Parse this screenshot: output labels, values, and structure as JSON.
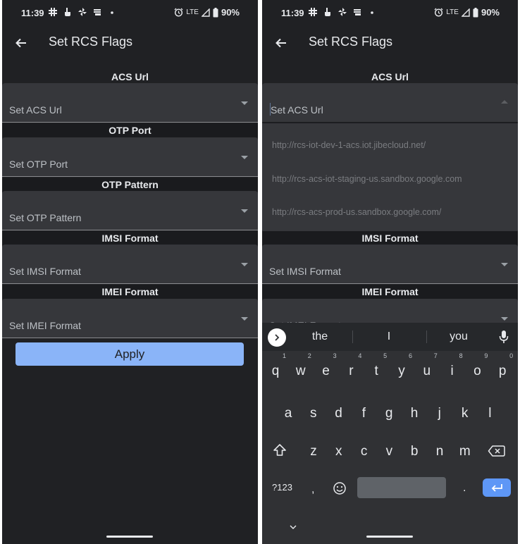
{
  "status_bar": {
    "time": "11:39",
    "left_icons": [
      "slack-icon",
      "hand-touch-icon",
      "pinwheel-icon",
      "notification-card-icon",
      "dot-icon"
    ],
    "right_icons": [
      "alarm-icon",
      "lte-label",
      "signal-icon",
      "battery-icon"
    ],
    "network": "LTE",
    "battery": "90%"
  },
  "app_bar": {
    "title": "Set RCS Flags",
    "back_icon": "arrow-back-icon"
  },
  "left_screen": {
    "sections": [
      {
        "header": "ACS Url",
        "value": "Set ACS Url"
      },
      {
        "header": "OTP Port",
        "value": "Set OTP Port"
      },
      {
        "header": "OTP Pattern",
        "value": "Set OTP Pattern"
      },
      {
        "header": "IMSI Format",
        "value": "Set IMSI Format"
      },
      {
        "header": "IMEI Format",
        "value": "Set IMEI Format"
      }
    ],
    "apply_label": "Apply"
  },
  "right_screen": {
    "sections": [
      {
        "header": "ACS Url",
        "value": "Set ACS Url"
      },
      {
        "header": "IMSI Format",
        "value": "Set IMSI Format"
      },
      {
        "header": "IMEI Format",
        "value": "Set IMEI Format"
      }
    ],
    "dropdown_options": [
      "http://rcs-iot-dev-1-acs.iot.jibecloud.net/",
      "http://rcs-acs-iot-staging-us.sandbox.google.com",
      "http://rcs-acs-prod-us.sandbox.google.com/"
    ]
  },
  "keyboard": {
    "suggestions": [
      "the",
      "I",
      "you"
    ],
    "row1": [
      {
        "key": "q",
        "hint": "1"
      },
      {
        "key": "w",
        "hint": "2"
      },
      {
        "key": "e",
        "hint": "3"
      },
      {
        "key": "r",
        "hint": "4"
      },
      {
        "key": "t",
        "hint": "5"
      },
      {
        "key": "y",
        "hint": "6"
      },
      {
        "key": "u",
        "hint": "7"
      },
      {
        "key": "i",
        "hint": "8"
      },
      {
        "key": "o",
        "hint": "9"
      },
      {
        "key": "p",
        "hint": "0"
      }
    ],
    "row2": [
      "a",
      "s",
      "d",
      "f",
      "g",
      "h",
      "j",
      "k",
      "l"
    ],
    "row3": [
      "z",
      "x",
      "c",
      "v",
      "b",
      "n",
      "m"
    ],
    "symbols_label": "?123",
    "comma": ",",
    "period": ".",
    "colors": {
      "enter": "#5e97f6",
      "accent": "#8ab4f8"
    }
  }
}
